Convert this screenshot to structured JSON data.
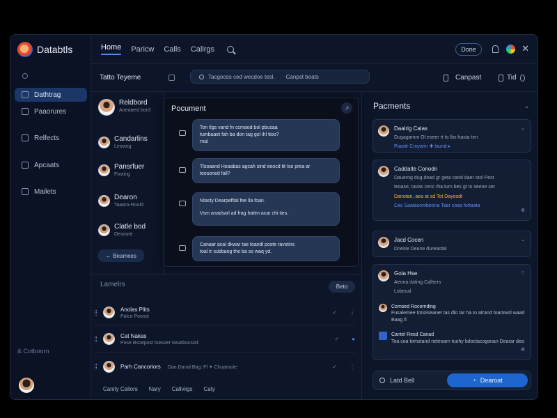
{
  "app": {
    "name": "Databtls",
    "done_label": "Done",
    "close_symbol": "✕"
  },
  "sidebar": {
    "items": [
      {
        "label": "Dathtrag"
      },
      {
        "label": "Paaorures"
      },
      {
        "label": "Relfects"
      },
      {
        "label": "Apcaats"
      },
      {
        "label": "Mailets"
      }
    ],
    "footer": "& Cotboorn"
  },
  "nav": {
    "items": [
      "Home",
      "Paricw",
      "Calls",
      "Callrgs"
    ]
  },
  "subbar": {
    "title": "Tatto Teyeme",
    "search_text": "Tacgooss ced wecdoe tesl.",
    "search_hint": "Canpst beats",
    "compact": "Canpast",
    "tail_text": "Tid"
  },
  "list_panel": {
    "profile": {
      "name": "Reldbord",
      "meta": "Aoeaaesl bord"
    },
    "contacts": [
      {
        "name": "Candarlins",
        "meta": "Leoving"
      },
      {
        "name": "Pansrfuer",
        "meta": "Fosting"
      },
      {
        "name": "Dearon",
        "meta": "Taaaro-Roold"
      },
      {
        "name": "Clatle bod",
        "meta": "Desoure"
      }
    ],
    "back_label": "← Beamees"
  },
  "document": {
    "title": "Pocument",
    "messages": [
      {
        "lines": [
          "Ton tlgs vand fn ccmaod bol pbusaa",
          "tumbaaet fah ba don tag gol ihl ttoo?",
          "rnal"
        ]
      },
      {
        "lines": [
          "Tlsoaand Heaabas agcah sind eeocd tit Ise prea ar",
          "teesoned fall?"
        ]
      },
      {
        "lines": [
          "Ntasty Dearpefltal fee lla foan."
        ],
        "second": "Vsm anadsarl ad frag hattm acar chi ties."
      },
      {
        "lines": [
          "Canaar acal dkwar tae toandl poste ravstins",
          "toal tr subbang the ba so waq yd."
        ]
      }
    ]
  },
  "lower_list": {
    "header": "Lamelrs",
    "action_label": "Beto",
    "rows": [
      {
        "name": "Anolas Plits",
        "meta": "Palco Poosst"
      },
      {
        "name": "Cat Nakas",
        "meta": "Pose Bsoepost tsesoer tasatbucsod"
      },
      {
        "name": "Parh Cancoriors",
        "meta": "Dan Danal Bag: Fl   ✦  Chuanorie"
      }
    ],
    "tabs": [
      "Canity Callors",
      "Nary",
      "Callviigs",
      "Caty"
    ]
  },
  "right_panel": {
    "title": "Pacments",
    "cards": [
      {
        "name": "Daalrig Calas",
        "line1": "Dugagamm Ol eseer rt to lbs hasta ten",
        "line2": "Piaodr Croyarin ✚  laund ▸"
      },
      {
        "name": "Caddaite Conodn",
        "line1": "Dauerng dug dead gr geta cand daer stol Pest",
        "line2": "teoase, tavas cenc tha tum bes gt to seeoe ser",
        "line3": "Danotan, aea at sd Tot Dayosdt",
        "line4": "Cas Saatasomboona  Taar coaa fortaata"
      },
      {
        "name": "Jacd Cocen",
        "line1": "Dnesie Deane dureaotal"
      },
      {
        "name": "Gola Hse",
        "line1": "Aeona dating Calhers",
        "line2": "Lobecal",
        "sub1_title": "Comsed Rocornding",
        "sub1_text": "Fusalemee torioiseanet tas dlo tar ha to atrand toamwol waad Baag tl",
        "sub2_title": "Cantel Resd Canad",
        "sub2_text": "Toa coa tomstand neteoarn tuohy bdoctacogonan Dearar dea"
      }
    ],
    "search_label": "Latd Bell",
    "button_label": "Dearoat"
  }
}
